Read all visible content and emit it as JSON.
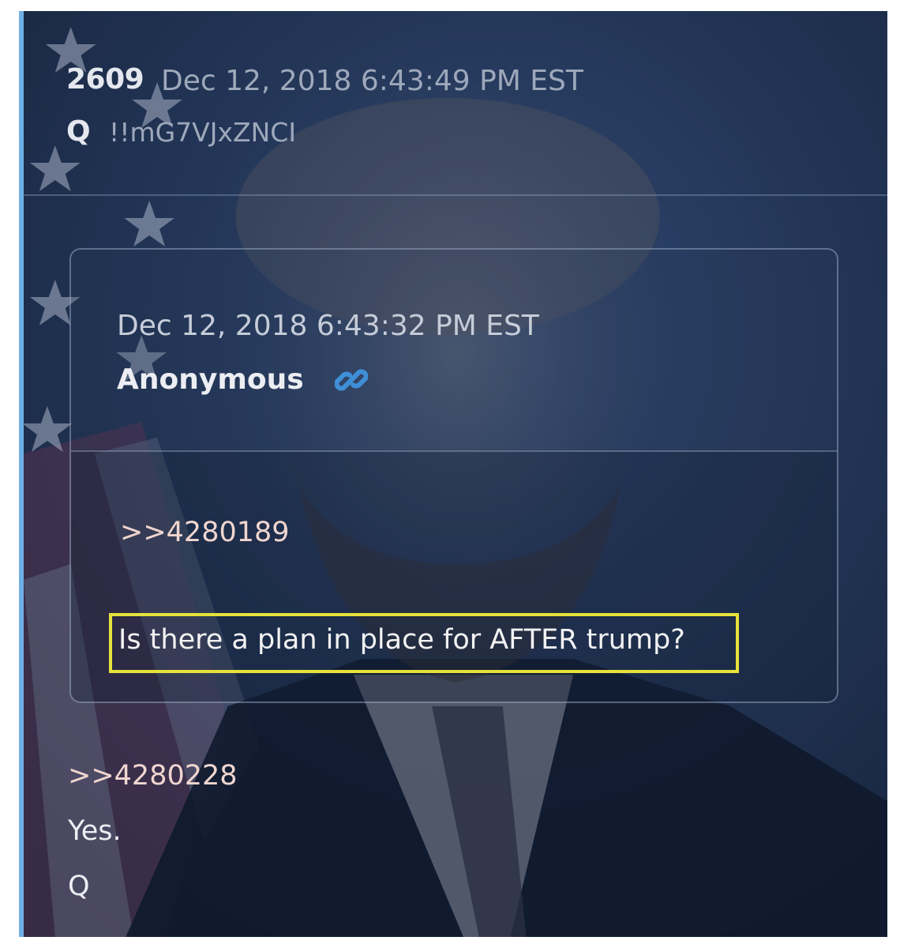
{
  "post": {
    "number": "2609",
    "date": "Dec 12, 2018 6:43:49 PM EST",
    "author": "Q",
    "tripcode": "!!mG7VJxZNCI"
  },
  "quoted_post": {
    "date": "Dec 12, 2018 6:43:32 PM EST",
    "author": "Anonymous",
    "link_icon": "link-icon",
    "reference": ">>4280189",
    "highlighted_text": "Is there a plan in place for AFTER trump?"
  },
  "reply": {
    "reference": ">>4280228",
    "text": "Yes.",
    "signature": "Q"
  },
  "colors": {
    "background": "#1c2c48",
    "accent_border": "#6fb0e4",
    "highlight": "#e6e23a",
    "reference_text": "#f0d6cf",
    "link_icon": "#3f8fd8"
  }
}
